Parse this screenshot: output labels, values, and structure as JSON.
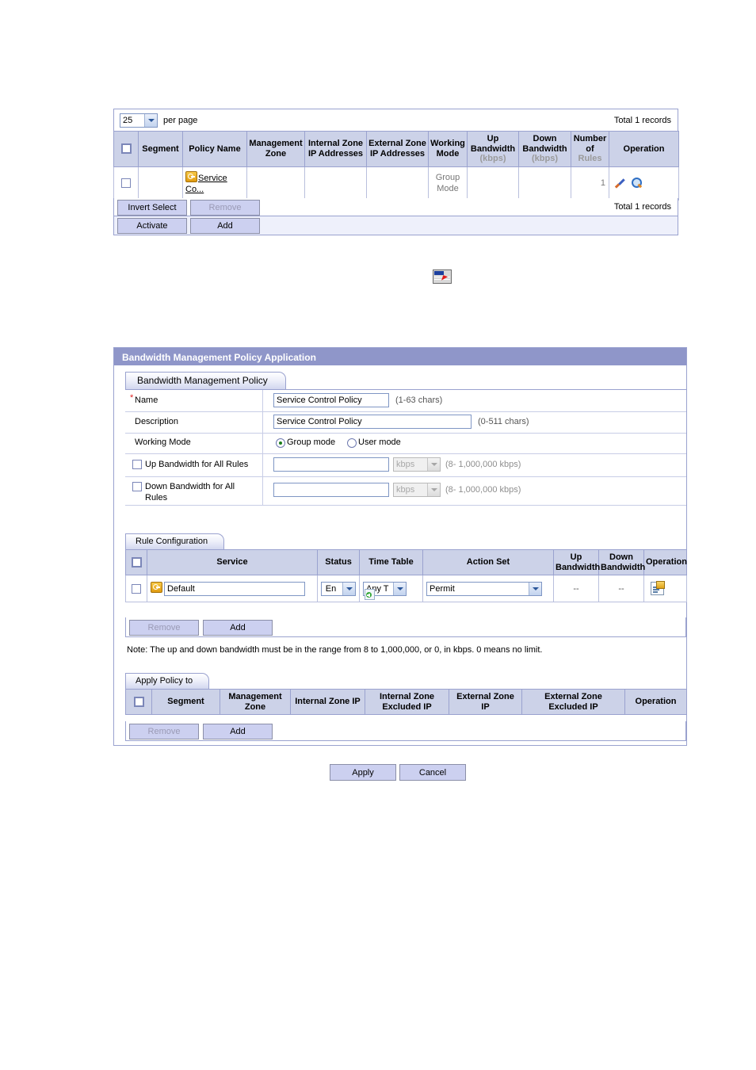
{
  "policy_list": {
    "page_size": {
      "value": "25",
      "suffix_label": "per page"
    },
    "total_top": "Total 1 records",
    "total_bottom": "Total 1 records",
    "columns": [
      "Segment",
      "Policy Name",
      "Management Zone",
      "Internal Zone IP Addresses",
      "External Zone IP Addresses",
      "Working Mode",
      "Up Bandwidth (kbps)",
      "Down Bandwidth (kbps)",
      "Number of Rules",
      "Operation"
    ],
    "columns_split": [
      {
        "l1": "Segment",
        "l2": ""
      },
      {
        "l1": "Policy Name",
        "l2": ""
      },
      {
        "l1": "Management",
        "l2": "Zone"
      },
      {
        "l1": "Internal Zone",
        "l2": "IP Addresses"
      },
      {
        "l1": "External Zone",
        "l2": "IP Addresses"
      },
      {
        "l1": "Working",
        "l2": "Mode"
      },
      {
        "l1": "Up",
        "l2": "Bandwidth",
        "l3": "(kbps)"
      },
      {
        "l1": "Down",
        "l2": "Bandwidth",
        "l3": "(kbps)"
      },
      {
        "l1": "Number",
        "l2": "of",
        "l3": "Rules"
      },
      {
        "l1": "Operation",
        "l2": ""
      }
    ],
    "rows": [
      {
        "segment": "",
        "policy_name": "Service Co...",
        "management_zone": "",
        "internal_zone_ip": "",
        "external_zone_ip": "",
        "working_mode": "Group Mode",
        "up_bandwidth": "",
        "down_bandwidth": "",
        "number_of_rules": "1"
      }
    ],
    "buttons": {
      "invert_select": "Invert Select",
      "remove": "Remove",
      "activate": "Activate",
      "add": "Add"
    }
  },
  "form": {
    "title": "Bandwidth Management Policy Application",
    "tab_policy": "Bandwidth Management Policy",
    "tab_rules": "Rule Configuration",
    "tab_apply": "Apply Policy to",
    "fields": {
      "name_label": "Name",
      "name_required_mark": "*",
      "name_value": "Service Control Policy",
      "name_hint": "(1-63   chars)",
      "description_label": "Description",
      "description_value": "Service Control Policy",
      "description_hint": "(0-511   chars)",
      "working_mode_label": "Working Mode",
      "working_mode_group": "Group mode",
      "working_mode_user": "User mode",
      "working_mode_selected": "Group mode",
      "up_bw_label": "Up Bandwidth for All Rules",
      "up_bw_value": "",
      "up_bw_unit": "kbps",
      "up_bw_hint": "(8- 1,000,000  kbps)",
      "up_bw_checked": false,
      "down_bw_label": "Down Bandwidth for All Rules",
      "down_bw_value": "",
      "down_bw_unit": "kbps",
      "down_bw_hint": "(8- 1,000,000  kbps)",
      "down_bw_checked": false
    },
    "rule_table": {
      "columns_split": [
        {
          "l1": "Service",
          "l2": ""
        },
        {
          "l1": "Status",
          "l2": ""
        },
        {
          "l1": "Time Table",
          "l2": ""
        },
        {
          "l1": "Action Set",
          "l2": ""
        },
        {
          "l1": "Up",
          "l2": "Bandwidth"
        },
        {
          "l1": "Down",
          "l2": "Bandwidth"
        },
        {
          "l1": "Operation",
          "l2": ""
        }
      ],
      "rows": [
        {
          "service": "Default",
          "status": "En",
          "time_table": "Any T",
          "action_set": "Permit",
          "up_bandwidth": "--",
          "down_bandwidth": "--"
        }
      ],
      "buttons": {
        "remove": "Remove",
        "add": "Add"
      }
    },
    "note": "Note: The up and down bandwidth must be in the range from 8 to 1,000,000, or 0, in kbps. 0 means no limit.",
    "apply_table": {
      "columns_split": [
        {
          "l1": "Segment",
          "l2": ""
        },
        {
          "l1": "Management",
          "l2": "Zone"
        },
        {
          "l1": "Internal Zone IP",
          "l2": ""
        },
        {
          "l1": "Internal Zone",
          "l2": "Excluded IP"
        },
        {
          "l1": "External Zone",
          "l2": "IP"
        },
        {
          "l1": "External Zone",
          "l2": "Excluded IP"
        },
        {
          "l1": "Operation",
          "l2": ""
        }
      ],
      "rows": [],
      "buttons": {
        "remove": "Remove",
        "add": "Add"
      }
    },
    "footer": {
      "apply": "Apply",
      "cancel": "Cancel"
    }
  },
  "colors": {
    "bar": "#8f96c9",
    "header_cell": "#ccd2e8",
    "button": "#ccd0f0",
    "border": "#9aa2cf",
    "required": "#e02020"
  }
}
